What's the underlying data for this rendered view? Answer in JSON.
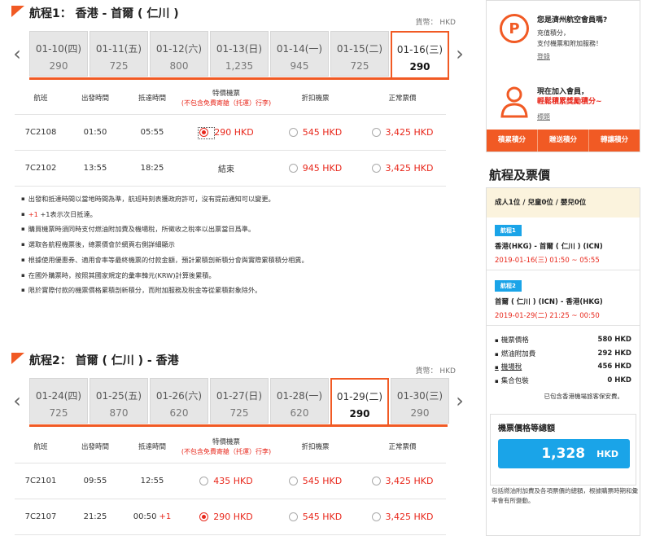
{
  "currency_label": "貨幣： HKD",
  "flight1": {
    "title": "航程1： 香港 - 首爾 ( 仁川 )",
    "dates": [
      {
        "date": "01-10(四)",
        "price": "290"
      },
      {
        "date": "01-11(五)",
        "price": "725"
      },
      {
        "date": "01-12(六)",
        "price": "800"
      },
      {
        "date": "01-13(日)",
        "price": "1,235"
      },
      {
        "date": "01-14(一)",
        "price": "945"
      },
      {
        "date": "01-15(二)",
        "price": "725"
      },
      {
        "date": "01-16(三)",
        "price": "290"
      }
    ],
    "rows": [
      {
        "flight": "7C2108",
        "dep": "01:50",
        "arr": "05:55",
        "arr_plus": "",
        "special": "290 HKD",
        "discount": "545 HKD",
        "normal": "3,425 HKD"
      },
      {
        "flight": "7C2102",
        "dep": "13:55",
        "arr": "18:25",
        "arr_plus": "",
        "special": "結束",
        "discount": "945 HKD",
        "normal": "3,425 HKD"
      }
    ]
  },
  "table_headers": {
    "flight": "航班",
    "dep": "出發時間",
    "arr": "抵達時間",
    "special": "特價機票",
    "special_sub": "(不包含免費寄艙（托運）行李)",
    "discount": "折扣機票",
    "normal": "正常票價"
  },
  "notes": [
    "出發和抵達時間以當地時間為準，航班時刻表獲政府許可，沒有提前通知可以變更。",
    "+1表示次日抵達。",
    "購買機票時須同時支付燃油附加費及機場稅，所徵收之稅率以出票當日爲準。",
    "選取各航程機票後，總票價會於網頁右側詳細顯示",
    "根據使用優惠券、適用會率等最終機票的付款金額，預計累積剖新積分會與實際累積積分相異。",
    "在國外購票時，按照其國家規定的彙率韓元(KRW)計算後累積。",
    "限於實際付款的機票價格累積剖新積分，而附加服務及稅金等從累積對象除外。"
  ],
  "note_plus": "+1",
  "flight2": {
    "title": "航程2： 首爾 ( 仁川 ) - 香港",
    "dates": [
      {
        "date": "01-24(四)",
        "price": "725"
      },
      {
        "date": "01-25(五)",
        "price": "870"
      },
      {
        "date": "01-26(六)",
        "price": "620"
      },
      {
        "date": "01-27(日)",
        "price": "725"
      },
      {
        "date": "01-28(一)",
        "price": "620"
      },
      {
        "date": "01-29(二)",
        "price": "290"
      },
      {
        "date": "01-30(三)",
        "price": "290"
      }
    ],
    "rows": [
      {
        "flight": "7C2101",
        "dep": "09:55",
        "arr": "12:55",
        "arr_plus": "",
        "special": "435 HKD",
        "discount": "545 HKD",
        "normal": "3,425 HKD"
      },
      {
        "flight": "7C2107",
        "dep": "21:25",
        "arr": "00:50",
        "arr_plus": "+1",
        "special": "290 HKD",
        "discount": "545 HKD",
        "normal": "3,425 HKD"
      }
    ]
  },
  "sidebar": {
    "promo1_title": "您是濟州航空會員嗎?",
    "promo1_line1": "充值積分，",
    "promo1_line2": "支付機票和附加服務！",
    "promo1_link": "登錄",
    "promo2_title": "現在加入會員，",
    "promo2_line": "輕鬆積累獎勵積分~",
    "promo2_link": "標題",
    "btn1": "積累積分",
    "btn2": "贈送積分",
    "btn3": "轉讓積分",
    "p_icon": "P"
  },
  "itinerary": {
    "title": "航程及票價",
    "pax": "成人1位 / 兒童0位 / 嬰兒0位",
    "seg1_tag": "航程1",
    "seg1_route": "香港(HKG) - 首爾 ( 仁川 ) (ICN)",
    "seg1_time": "2019-01-16(三) 01:50 ~ 05:55",
    "seg2_tag": "航程2",
    "seg2_route": "首爾 ( 仁川 ) (ICN) - 香港(HKG)",
    "seg2_time": "2019-01-29(二) 21:25 ~ 00:50",
    "fares": [
      {
        "label": "機票價格",
        "value": "580 HKD"
      },
      {
        "label": "燃油附加費",
        "value": "292 HKD"
      },
      {
        "label": "機場稅",
        "value": "456 HKD"
      },
      {
        "label": "集合包裝",
        "value": "0 HKD"
      }
    ],
    "hkg_note": "已包含香港機場旅客保安費。",
    "total_label": "機票價格等總額",
    "total_amount": "1,328",
    "total_currency": "HKD",
    "footnote": "包括燃油附加費及各項票價的總額，根據購票時期和彙率會有所變動。"
  },
  "colors": {
    "accent": "#f15a24",
    "price_red": "#e8271b",
    "blue": "#1aa4e8"
  }
}
